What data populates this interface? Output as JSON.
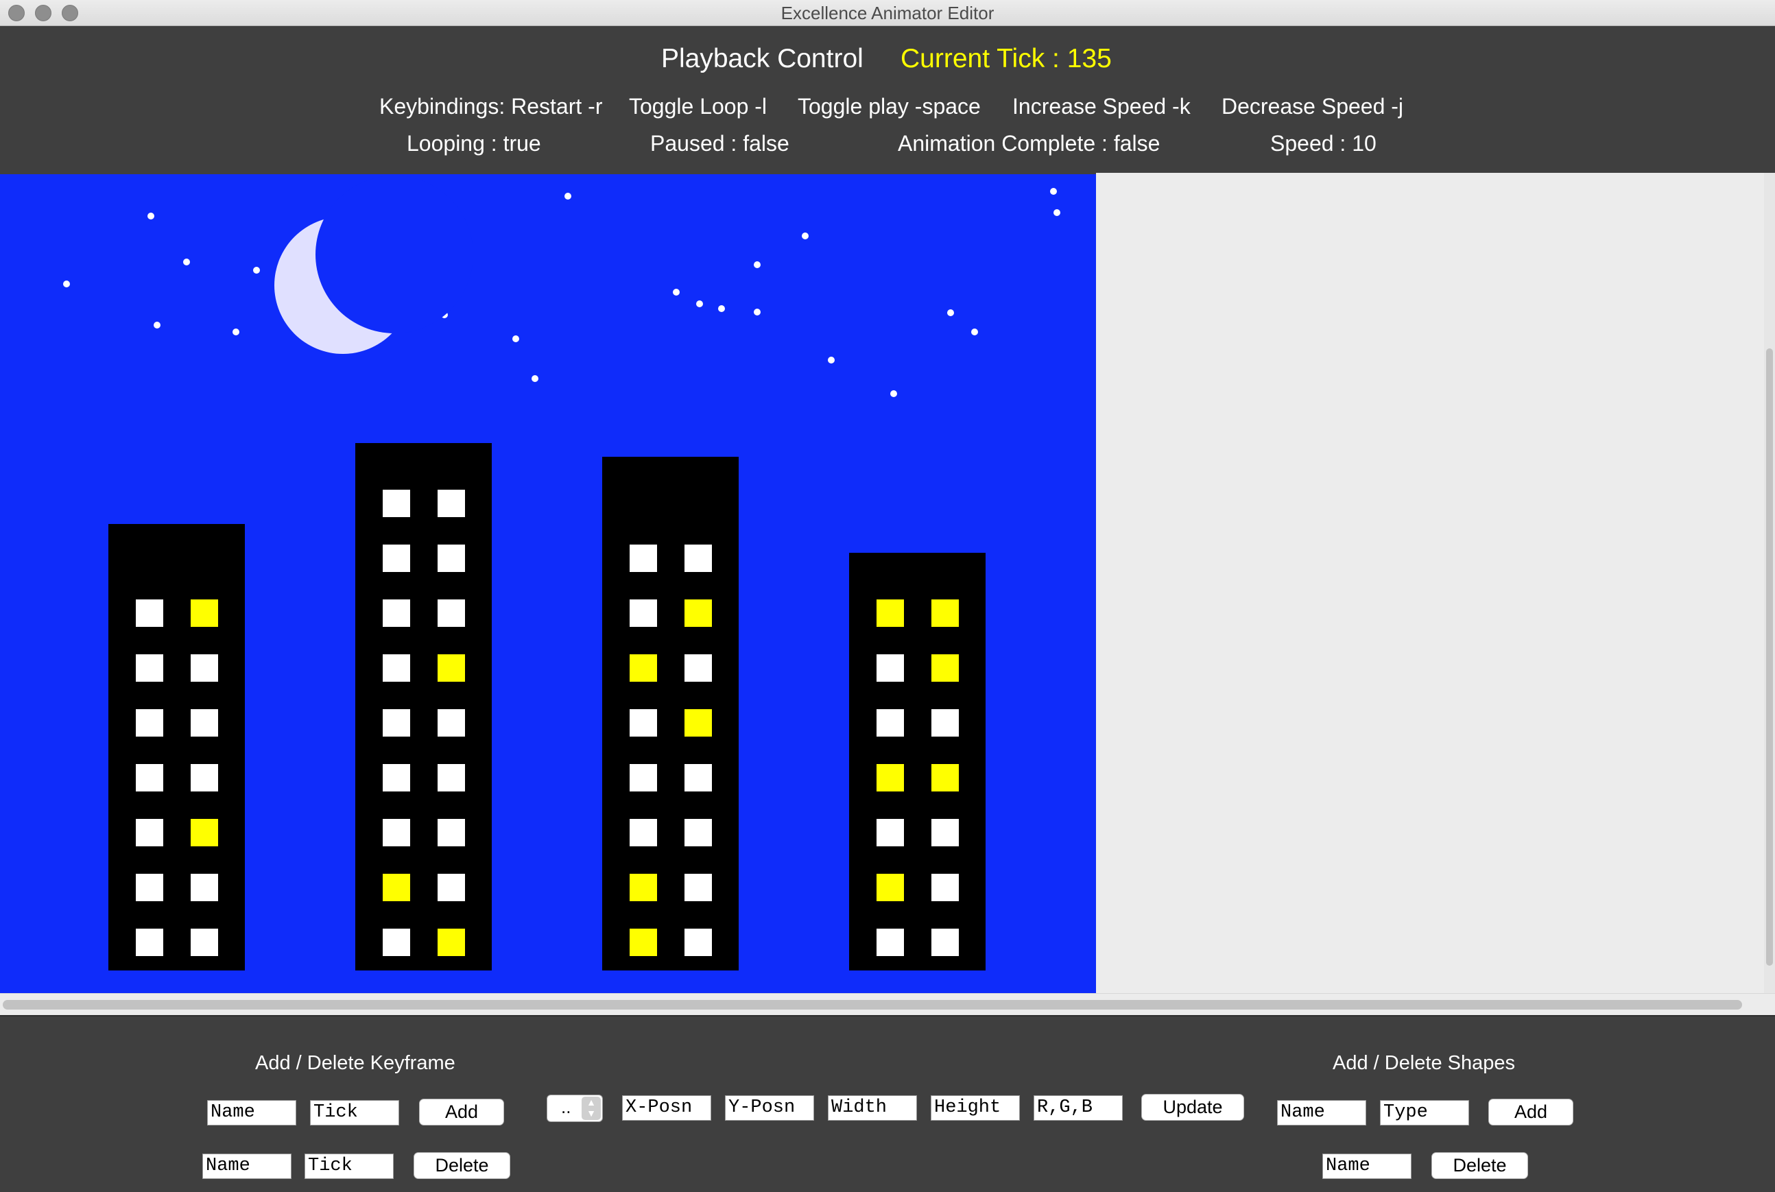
{
  "window": {
    "title": "Excellence Animator Editor"
  },
  "header": {
    "title": "Playback Control",
    "current_tick": "Current Tick : 135",
    "keybindings": {
      "restart": "Keybindings: Restart -r",
      "toggle_loop": "Toggle Loop -l",
      "toggle_play": "Toggle play -space",
      "increase_speed": "Increase Speed -k",
      "decrease_speed": "Decrease Speed -j"
    },
    "status": {
      "looping": "Looping : true",
      "paused": "Paused : false",
      "complete": "Animation Complete : false",
      "speed": "Speed : 10"
    }
  },
  "colors": {
    "sky": "#0f2cfa",
    "building": "#000000",
    "window_off": "#ffffff",
    "window_lit": "#ffff00",
    "moon": "#e0e0ff",
    "star": "#ffffff",
    "tick_text": "#ffff00"
  },
  "scene": {
    "buildings": [
      {
        "windows": [
          [
            "w",
            "y"
          ],
          [
            "w",
            "w"
          ],
          [
            "w",
            "w"
          ],
          [
            "w",
            "w"
          ],
          [
            "w",
            "y"
          ],
          [
            "w",
            "w"
          ],
          [
            "w",
            "w"
          ]
        ]
      },
      {
        "windows": [
          [
            "w",
            "w"
          ],
          [
            "w",
            "w"
          ],
          [
            "w",
            "w"
          ],
          [
            "w",
            "y"
          ],
          [
            "w",
            "w"
          ],
          [
            "w",
            "w"
          ],
          [
            "w",
            "w"
          ],
          [
            "y",
            "w"
          ],
          [
            "w",
            "y"
          ]
        ]
      },
      {
        "windows": [
          [
            "w",
            "w"
          ],
          [
            "w",
            "y"
          ],
          [
            "y",
            "w"
          ],
          [
            "w",
            "y"
          ],
          [
            "w",
            "w"
          ],
          [
            "w",
            "w"
          ],
          [
            "y",
            "w"
          ],
          [
            "y",
            "w"
          ]
        ]
      },
      {
        "windows": [
          [
            "y",
            "y"
          ],
          [
            "w",
            "y"
          ],
          [
            "w",
            "w"
          ],
          [
            "y",
            "y"
          ],
          [
            "w",
            "w"
          ],
          [
            "y",
            "w"
          ],
          [
            "w",
            "w"
          ]
        ]
      }
    ]
  },
  "keyframe_panel": {
    "title": "Add / Delete Keyframe",
    "add_row": {
      "name_value": "Name",
      "tick_value": "Tick",
      "add_label": "Add"
    },
    "delete_row": {
      "name_value": "Name",
      "tick_value": "Tick",
      "delete_label": "Delete"
    }
  },
  "update_panel": {
    "spinner_value": "..",
    "x_value": "X-Posn",
    "y_value": "Y-Posn",
    "width_value": "Width",
    "height_value": "Height",
    "rgb_value": "R,G,B",
    "update_label": "Update"
  },
  "shapes_panel": {
    "title": "Add / Delete Shapes",
    "add_row": {
      "name_value": "Name",
      "type_value": "Type",
      "add_label": "Add"
    },
    "delete_row": {
      "name_value": "Name",
      "delete_label": "Delete"
    }
  }
}
